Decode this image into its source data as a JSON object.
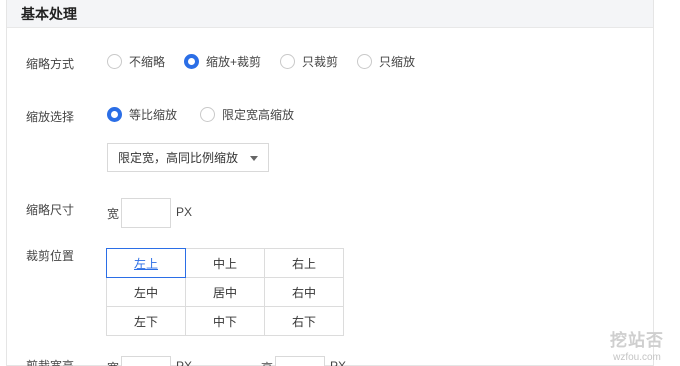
{
  "section": {
    "title": "基本处理"
  },
  "thumb_mode": {
    "label": "缩略方式",
    "options": [
      "不缩略",
      "缩放+裁剪",
      "只裁剪",
      "只缩放"
    ],
    "selected": "缩放+裁剪"
  },
  "scale_choice": {
    "label": "缩放选择",
    "options": [
      "等比缩放",
      "限定宽高缩放"
    ],
    "selected": "等比缩放",
    "dropdown_value": "限定宽，高同比例缩放"
  },
  "thumb_size": {
    "label": "缩略尺寸",
    "prefix": "宽",
    "value": "",
    "unit": "PX"
  },
  "crop_position": {
    "label": "裁剪位置",
    "cells": [
      [
        "左上",
        "中上",
        "右上"
      ],
      [
        "左中",
        "居中",
        "右中"
      ],
      [
        "左下",
        "中下",
        "右下"
      ]
    ],
    "selected": "左上"
  },
  "crop_size": {
    "label": "剪裁宽高",
    "width_prefix": "宽",
    "height_prefix": "高",
    "unit": "PX"
  },
  "watermark": {
    "logo": "挖站否",
    "url": "wzfou.com"
  },
  "colors": {
    "accent": "#2b6ee6",
    "header_bg": "#f4f5f7",
    "border": "#dcdcdc"
  }
}
